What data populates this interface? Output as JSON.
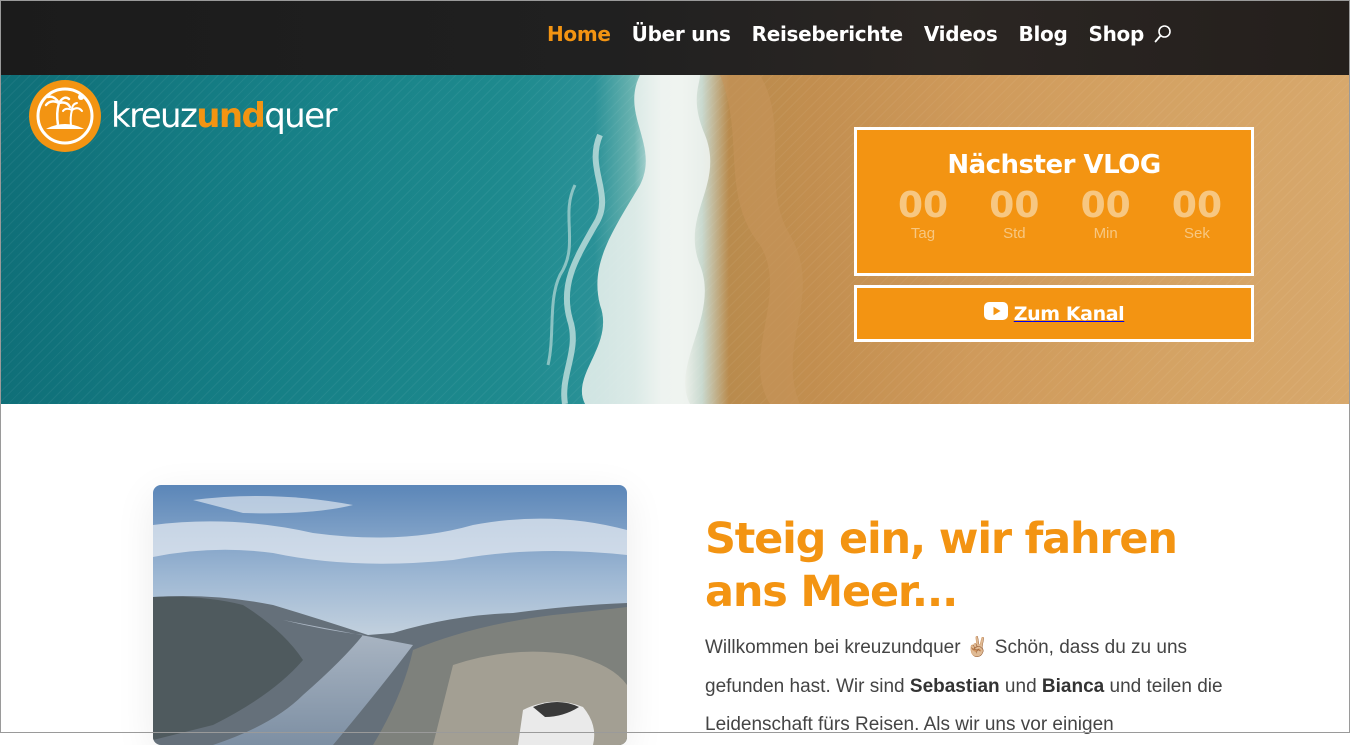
{
  "nav": {
    "items": [
      {
        "label": "Home",
        "active": true
      },
      {
        "label": "Über uns",
        "active": false
      },
      {
        "label": "Reiseberichte",
        "active": false
      },
      {
        "label": "Videos",
        "active": false
      },
      {
        "label": "Blog",
        "active": false
      },
      {
        "label": "Shop",
        "active": false
      }
    ],
    "search_icon": "search-icon"
  },
  "logo": {
    "part1": "kreuz",
    "part2": "und",
    "part3": "quer"
  },
  "countdown": {
    "title": "Nächster VLOG",
    "units": [
      {
        "value": "00",
        "label": "Tag"
      },
      {
        "value": "00",
        "label": "Std"
      },
      {
        "value": "00",
        "label": "Min"
      },
      {
        "value": "00",
        "label": "Sek"
      }
    ]
  },
  "channel_button": {
    "label": "Zum Kanal",
    "icon": "youtube-icon"
  },
  "content": {
    "headline": "Steig ein, wir fahren ans Meer...",
    "intro": {
      "t1": "Willkommen bei kreuzundquer ",
      "emoji": "✌🏼",
      "t2": " Schön, dass du zu uns gefunden hast. Wir sind ",
      "name1": "Sebastian",
      "t3": " und ",
      "name2": "Bianca",
      "t4": " und teilen die Leidenschaft fürs Reisen. Als wir uns vor einigen"
    }
  },
  "colors": {
    "accent": "#f39412",
    "topbar": "#1e1e1e",
    "text": "#444444"
  }
}
